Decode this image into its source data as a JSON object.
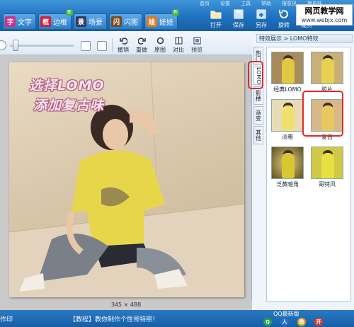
{
  "menu": [
    "首页",
    "设置",
    "工具",
    "帮助",
    "搜意见",
    "换皮肤"
  ],
  "tabs": [
    {
      "label": "文字",
      "icon": "text-icon",
      "icon_char": "字",
      "color": "#d0308a"
    },
    {
      "label": "边框",
      "icon": "frame-icon",
      "icon_char": "框",
      "color": "#d02040",
      "badge": "新"
    },
    {
      "label": "场景",
      "icon": "scene-icon",
      "icon_char": "景",
      "color": "#303a60"
    },
    {
      "label": "闪图",
      "icon": "flash-icon",
      "icon_char": "闪",
      "color": "#7a4a20"
    },
    {
      "label": "娃娃",
      "icon": "doll-icon",
      "icon_char": "娃",
      "color": "#e07a20",
      "badge": "新"
    }
  ],
  "toolbar": [
    {
      "label": "打开",
      "icon": "open-icon"
    },
    {
      "label": "保存",
      "icon": "save-icon"
    },
    {
      "label": "另存",
      "icon": "save-as-icon"
    },
    {
      "label": "旋转",
      "icon": "rotate-icon"
    },
    {
      "label": "裁剪",
      "icon": "crop-icon"
    }
  ],
  "watermark": {
    "line1": "网页教学网",
    "line2": "www.webjx.com"
  },
  "edit": {
    "undo": "撤销",
    "redo": "重做",
    "original": "原图",
    "compare": "对比",
    "preview": "预览"
  },
  "caption": {
    "line1": "选择LOMO",
    "line2": "添加复古味"
  },
  "image_size": "345 × 488",
  "panel": {
    "header": "特效展示 > LOMO特效",
    "vtabs": [
      "热门",
      "LOMO",
      "影楼",
      "渐变",
      "其他"
    ],
    "active_vtab": 1,
    "effects": [
      {
        "label": "经典LOMO",
        "tone": "#a88a5c"
      },
      {
        "label": "胶片",
        "tone": "#c8b078"
      },
      {
        "label": "淡雅",
        "tone": "#e8dcb8"
      },
      {
        "label": "复古",
        "tone": "#d8b888"
      },
      {
        "label": "泛黄暗角",
        "tone": "#b0a040"
      },
      {
        "label": "哥特风",
        "tone": "#d0c848"
      }
    ],
    "highlighted_effect": 3
  },
  "status": {
    "left": "作印",
    "tip": "【教程】教你制作个性哥特照！",
    "version": "QQ最新版",
    "socials": [
      {
        "name": "qzone-icon",
        "char": "Q",
        "color": "#2aa04a"
      },
      {
        "name": "renren-icon",
        "char": "人",
        "color": "#2a70c8"
      },
      {
        "name": "weibo-icon",
        "char": "微",
        "color": "#e0a020"
      },
      {
        "name": "kaixin-icon",
        "char": "开",
        "color": "#d83a2a"
      }
    ]
  }
}
